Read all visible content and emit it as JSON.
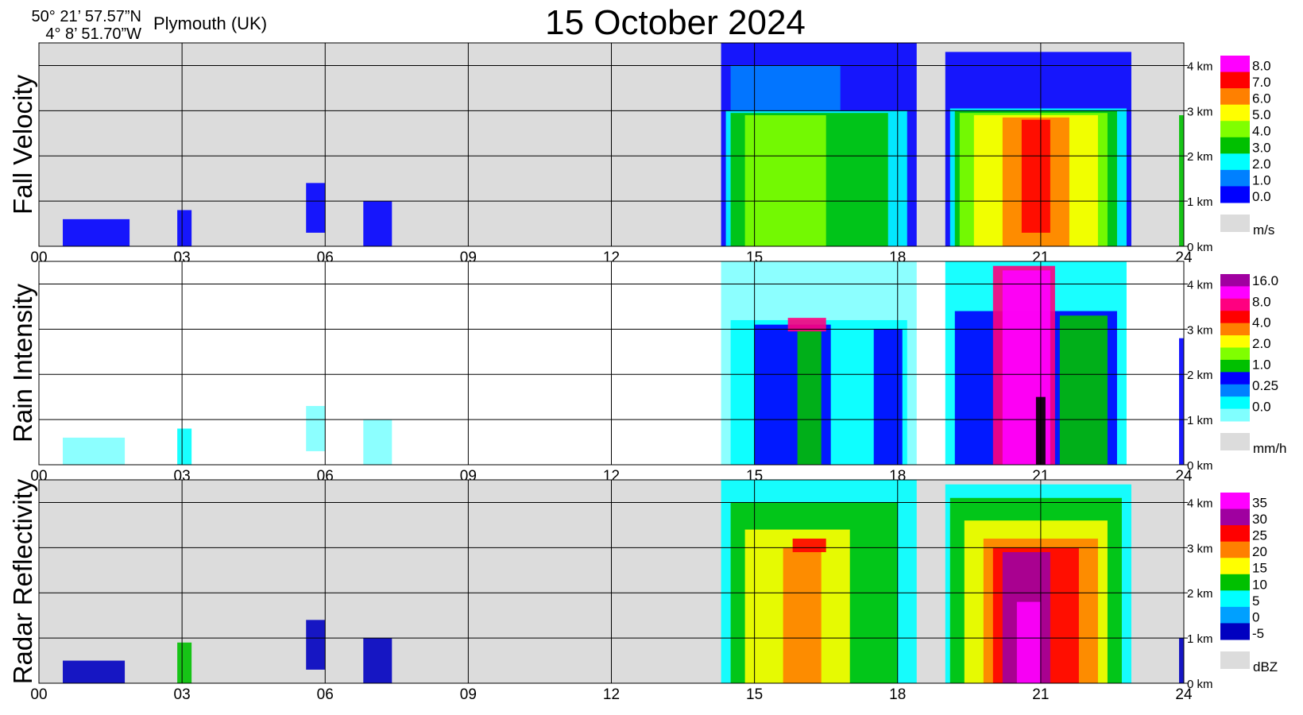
{
  "header": {
    "lat": "50° 21’ 57.57”N",
    "lon": "4°  8’ 51.70”W",
    "location": "Plymouth (UK)",
    "title": "15 October  2024"
  },
  "chart_data": [
    {
      "type": "heatmap",
      "panel": "fall-velocity",
      "ylabel": "Fall Velocity",
      "x_ticks": [
        "00",
        "03",
        "06",
        "09",
        "12",
        "15",
        "18",
        "21",
        "24"
      ],
      "xlim": [
        0,
        24
      ],
      "y_ticks": [
        "0 km",
        "1 km",
        "2 km",
        "3 km",
        "4 km"
      ],
      "ylim": [
        0,
        4.5
      ],
      "background": "#dcdcdc",
      "legend": {
        "unit": "m/s",
        "colors": [
          "#ff00ff",
          "#ff0000",
          "#ff8000",
          "#ffff00",
          "#80ff00",
          "#00c000",
          "#00ffff",
          "#0080ff",
          "#0000ff"
        ],
        "labels": [
          "8.0",
          "7.0",
          "6.0",
          "5.0",
          "4.0",
          "3.0",
          "2.0",
          "1.0",
          "0.0"
        ]
      },
      "regions": [
        {
          "x": [
            0.5,
            1.9
          ],
          "y": [
            0,
            0.6
          ],
          "fill": "#0000ff"
        },
        {
          "x": [
            2.9,
            3.2
          ],
          "y": [
            0,
            0.8
          ],
          "fill": "#0000ff"
        },
        {
          "x": [
            5.6,
            6.0
          ],
          "y": [
            0.3,
            1.4
          ],
          "fill": "#0000ff"
        },
        {
          "x": [
            6.8,
            7.4
          ],
          "y": [
            0,
            1.0
          ],
          "fill": "#0000ff"
        },
        {
          "x": [
            14.3,
            18.4
          ],
          "y": [
            0,
            4.5
          ],
          "fill": "#0000ff"
        },
        {
          "x": [
            14.5,
            16.8
          ],
          "y": [
            3.0,
            4.0
          ],
          "fill": "#0080ff"
        },
        {
          "x": [
            14.4,
            18.2
          ],
          "y": [
            0,
            3.0
          ],
          "fill": "#00ffff"
        },
        {
          "x": [
            14.5,
            17.8
          ],
          "y": [
            0,
            2.95
          ],
          "fill": "#00c000"
        },
        {
          "x": [
            14.8,
            16.5
          ],
          "y": [
            0,
            2.9
          ],
          "fill": "#80ff00"
        },
        {
          "x": [
            19.0,
            22.9
          ],
          "y": [
            0,
            4.3
          ],
          "fill": "#0000ff"
        },
        {
          "x": [
            19.1,
            22.8
          ],
          "y": [
            0,
            3.05
          ],
          "fill": "#00ffff"
        },
        {
          "x": [
            19.2,
            22.6
          ],
          "y": [
            0,
            3.0
          ],
          "fill": "#00c000"
        },
        {
          "x": [
            19.3,
            22.4
          ],
          "y": [
            0,
            2.95
          ],
          "fill": "#80ff00"
        },
        {
          "x": [
            19.6,
            22.2
          ],
          "y": [
            0,
            2.9
          ],
          "fill": "#ffff00"
        },
        {
          "x": [
            20.2,
            21.6
          ],
          "y": [
            0,
            2.85
          ],
          "fill": "#ff8000"
        },
        {
          "x": [
            20.6,
            21.2
          ],
          "y": [
            0.3,
            2.8
          ],
          "fill": "#ff0000"
        },
        {
          "x": [
            23.9,
            24.0
          ],
          "y": [
            0,
            2.9
          ],
          "fill": "#00c000"
        }
      ]
    },
    {
      "type": "heatmap",
      "panel": "rain-intensity",
      "ylabel": "Rain Intensity",
      "x_ticks": [
        "00",
        "03",
        "06",
        "09",
        "12",
        "15",
        "18",
        "21",
        "24"
      ],
      "xlim": [
        0,
        24
      ],
      "y_ticks": [
        "0 km",
        "1 km",
        "2 km",
        "3 km",
        "4 km"
      ],
      "ylim": [
        0,
        4.5
      ],
      "background": "#ffffff",
      "legend": {
        "unit": "mm/h",
        "colors": [
          "#a000a0",
          "#ff00ff",
          "#ff0080",
          "#ff0000",
          "#ff8000",
          "#ffff00",
          "#80ff00",
          "#00c000",
          "#0000ff",
          "#0080ff",
          "#00ffff",
          "#80ffff"
        ],
        "labels": [
          "16.0",
          "8.0",
          "4.0",
          "2.0",
          "1.0",
          "0.25",
          "0.0"
        ]
      },
      "regions": [
        {
          "x": [
            0.5,
            1.8
          ],
          "y": [
            0,
            0.6
          ],
          "fill": "#80ffff"
        },
        {
          "x": [
            2.9,
            3.2
          ],
          "y": [
            0,
            0.8
          ],
          "fill": "#00ffff"
        },
        {
          "x": [
            5.6,
            6.0
          ],
          "y": [
            0.3,
            1.3
          ],
          "fill": "#80ffff"
        },
        {
          "x": [
            6.8,
            7.4
          ],
          "y": [
            0,
            1.0
          ],
          "fill": "#80ffff"
        },
        {
          "x": [
            14.3,
            18.4
          ],
          "y": [
            0,
            4.5
          ],
          "fill": "#80ffff"
        },
        {
          "x": [
            14.5,
            18.2
          ],
          "y": [
            0,
            3.2
          ],
          "fill": "#00ffff"
        },
        {
          "x": [
            15.0,
            16.6
          ],
          "y": [
            0,
            3.1
          ],
          "fill": "#0000ff"
        },
        {
          "x": [
            15.9,
            16.4
          ],
          "y": [
            0,
            3.0
          ],
          "fill": "#00c000"
        },
        {
          "x": [
            15.7,
            16.5
          ],
          "y": [
            2.95,
            3.25
          ],
          "fill": "#ff0080"
        },
        {
          "x": [
            17.5,
            18.1
          ],
          "y": [
            0,
            3.0
          ],
          "fill": "#0000ff"
        },
        {
          "x": [
            19.0,
            22.8
          ],
          "y": [
            0,
            4.5
          ],
          "fill": "#00ffff"
        },
        {
          "x": [
            19.2,
            22.6
          ],
          "y": [
            0,
            3.4
          ],
          "fill": "#0000ff"
        },
        {
          "x": [
            20.0,
            21.3
          ],
          "y": [
            0,
            4.4
          ],
          "fill": "#ff0080"
        },
        {
          "x": [
            20.2,
            21.2
          ],
          "y": [
            0,
            4.3
          ],
          "fill": "#ff00ff"
        },
        {
          "x": [
            20.9,
            21.1
          ],
          "y": [
            0,
            1.5
          ],
          "fill": "#000000"
        },
        {
          "x": [
            21.4,
            22.4
          ],
          "y": [
            0,
            3.3
          ],
          "fill": "#00c000"
        },
        {
          "x": [
            23.9,
            24.0
          ],
          "y": [
            0,
            2.8
          ],
          "fill": "#0000ff"
        }
      ]
    },
    {
      "type": "heatmap",
      "panel": "radar-reflectivity",
      "ylabel": "Radar Reflectivity",
      "x_ticks": [
        "00",
        "03",
        "06",
        "09",
        "12",
        "15",
        "18",
        "21",
        "24"
      ],
      "xlim": [
        0,
        24
      ],
      "y_ticks": [
        "0 km",
        "1 km",
        "2 km",
        "3 km",
        "4 km"
      ],
      "ylim": [
        0,
        4.5
      ],
      "background": "#dcdcdc",
      "legend": {
        "unit": "dBZ",
        "colors": [
          "#ff00ff",
          "#a000a0",
          "#ff0000",
          "#ff8000",
          "#ffff00",
          "#00c000",
          "#00ffff",
          "#00a0ff",
          "#0000c0"
        ],
        "labels": [
          "35",
          "30",
          "25",
          "20",
          "15",
          "10",
          "5",
          "0",
          "-5"
        ]
      },
      "regions": [
        {
          "x": [
            0.5,
            1.8
          ],
          "y": [
            0,
            0.5
          ],
          "fill": "#0000c0"
        },
        {
          "x": [
            2.9,
            3.2
          ],
          "y": [
            0,
            0.9
          ],
          "fill": "#00c000"
        },
        {
          "x": [
            5.6,
            6.0
          ],
          "y": [
            0.3,
            1.4
          ],
          "fill": "#0000c0"
        },
        {
          "x": [
            6.8,
            7.4
          ],
          "y": [
            0,
            1.0
          ],
          "fill": "#0000c0"
        },
        {
          "x": [
            14.3,
            18.4
          ],
          "y": [
            0,
            4.5
          ],
          "fill": "#00ffff"
        },
        {
          "x": [
            14.5,
            18.0
          ],
          "y": [
            0,
            4.0
          ],
          "fill": "#00c000"
        },
        {
          "x": [
            14.8,
            17.0
          ],
          "y": [
            0,
            3.4
          ],
          "fill": "#ffff00"
        },
        {
          "x": [
            15.6,
            16.4
          ],
          "y": [
            0,
            3.0
          ],
          "fill": "#ff8000"
        },
        {
          "x": [
            15.8,
            16.5
          ],
          "y": [
            2.9,
            3.2
          ],
          "fill": "#ff0000"
        },
        {
          "x": [
            19.0,
            22.9
          ],
          "y": [
            0,
            4.4
          ],
          "fill": "#00ffff"
        },
        {
          "x": [
            19.1,
            22.7
          ],
          "y": [
            0,
            4.1
          ],
          "fill": "#00c000"
        },
        {
          "x": [
            19.4,
            22.4
          ],
          "y": [
            0,
            3.6
          ],
          "fill": "#ffff00"
        },
        {
          "x": [
            19.8,
            22.2
          ],
          "y": [
            0,
            3.2
          ],
          "fill": "#ff8000"
        },
        {
          "x": [
            20.0,
            21.8
          ],
          "y": [
            0,
            3.0
          ],
          "fill": "#ff0000"
        },
        {
          "x": [
            20.2,
            21.2
          ],
          "y": [
            0,
            2.9
          ],
          "fill": "#a000a0"
        },
        {
          "x": [
            20.5,
            21.0
          ],
          "y": [
            0,
            1.8
          ],
          "fill": "#ff00ff"
        },
        {
          "x": [
            23.9,
            24.0
          ],
          "y": [
            0,
            1.0
          ],
          "fill": "#0000c0"
        }
      ]
    }
  ]
}
